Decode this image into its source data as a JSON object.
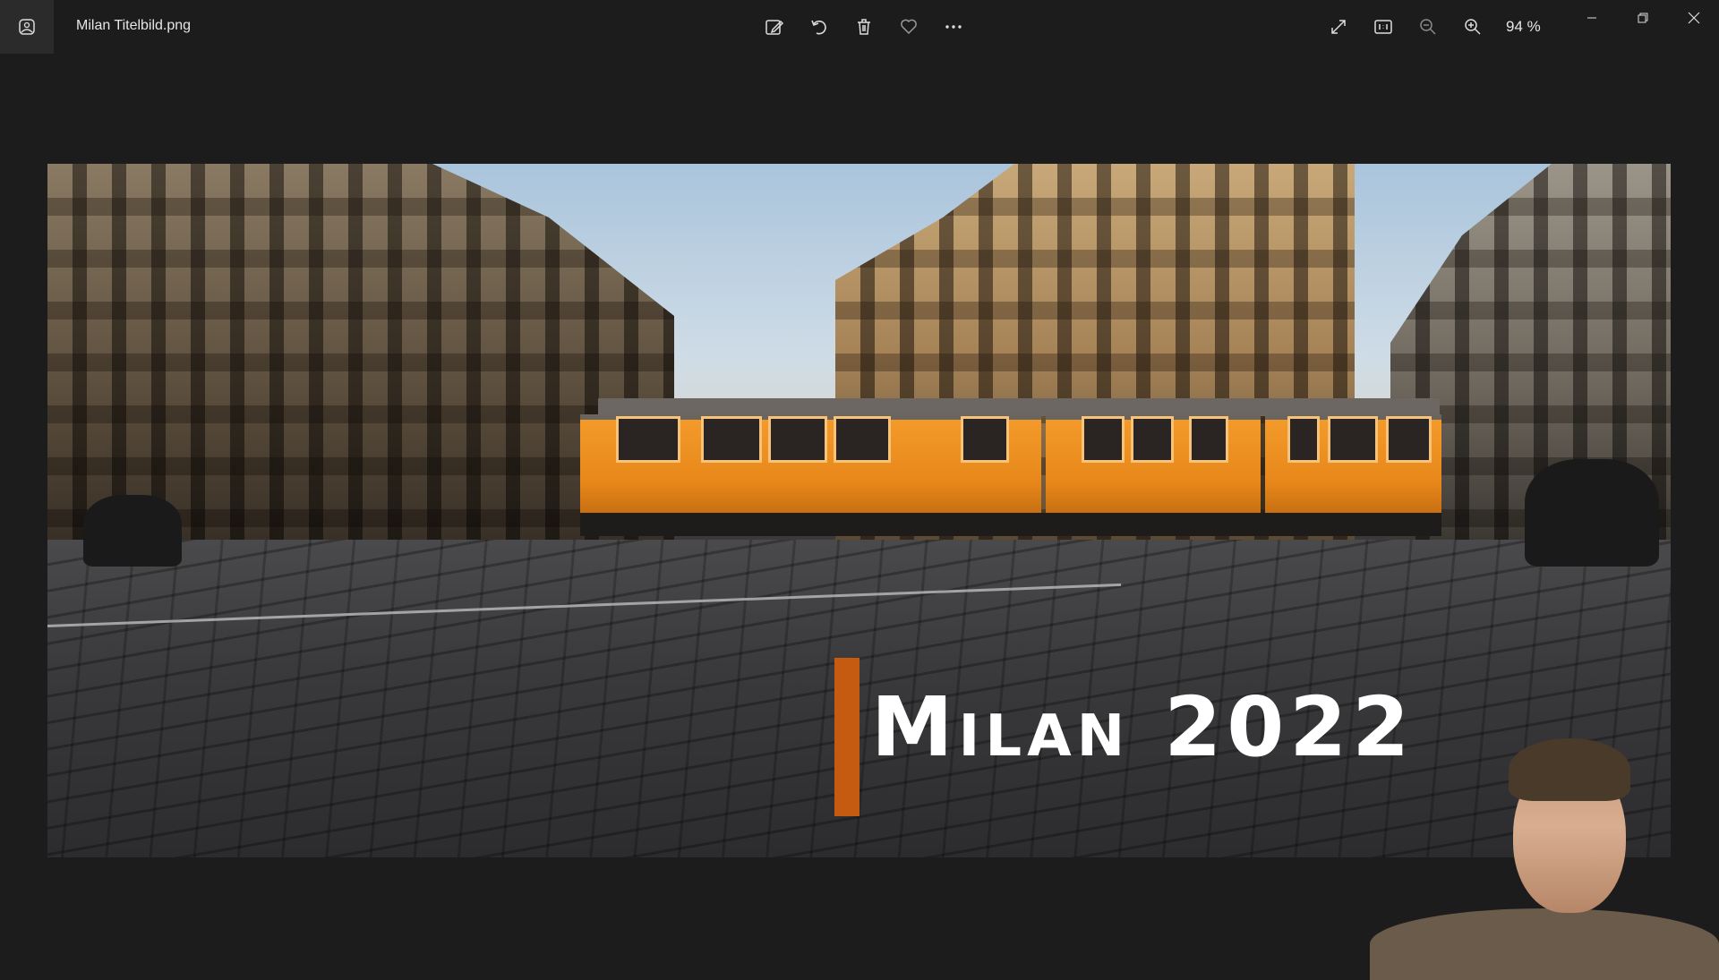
{
  "titlebar": {
    "filename": "Milan Titelbild.png",
    "zoom_label": "94 %"
  },
  "icons": {
    "app": "photo-viewer-icon",
    "edit": "edit-image-icon",
    "rotate": "rotate-icon",
    "delete": "trash-icon",
    "favorite": "heart-icon",
    "more": "more-options-icon",
    "fullscreen": "expand-icon",
    "actual_size": "actual-size-icon",
    "zoom_out": "zoom-out-icon",
    "zoom_in": "zoom-in-icon",
    "minimize": "minimize-icon",
    "restore": "restore-icon",
    "close": "close-icon"
  },
  "image": {
    "title_text": "Milan 2022"
  },
  "colors": {
    "background": "#1c1c1c",
    "accent_bar": "#c55a11",
    "tram": "#e8871a"
  }
}
